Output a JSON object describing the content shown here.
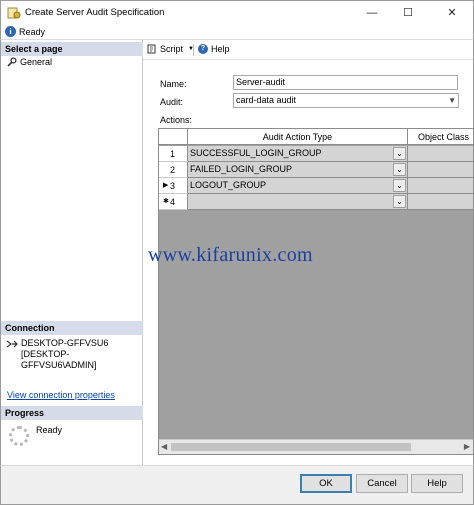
{
  "window": {
    "title": "Create Server Audit Specification",
    "controls": {
      "minimize": "—",
      "maximize": "☐",
      "close": "✕"
    }
  },
  "status": {
    "text": "Ready"
  },
  "left_pane": {
    "select_page_header": "Select a page",
    "pages": [
      {
        "label": "General"
      }
    ],
    "connection_header": "Connection",
    "connection_lines": [
      "DESKTOP-GFFVSU6",
      "[DESKTOP-GFFVSU6\\ADMIN]"
    ],
    "connection_link": "View connection properties",
    "progress_header": "Progress",
    "progress_status": "Ready"
  },
  "toolbar": {
    "script_label": "Script",
    "help_label": "Help"
  },
  "form": {
    "name_label": "Name:",
    "name_value": "Server-audit",
    "audit_label": "Audit:",
    "audit_value": "card-data audit",
    "actions_label": "Actions:"
  },
  "grid": {
    "columns": [
      "Audit Action Type",
      "Object Class"
    ],
    "rows": [
      {
        "num": "1",
        "marker": "",
        "action": "SUCCESSFUL_LOGIN_GROUP"
      },
      {
        "num": "2",
        "marker": "",
        "action": "FAILED_LOGIN_GROUP"
      },
      {
        "num": "3",
        "marker": "▶",
        "action": "LOGOUT_GROUP"
      },
      {
        "num": "4",
        "marker": "✱",
        "action": ""
      }
    ]
  },
  "watermark": "www.kifarunix.com",
  "footer": {
    "ok": "OK",
    "cancel": "Cancel",
    "help": "Help"
  }
}
